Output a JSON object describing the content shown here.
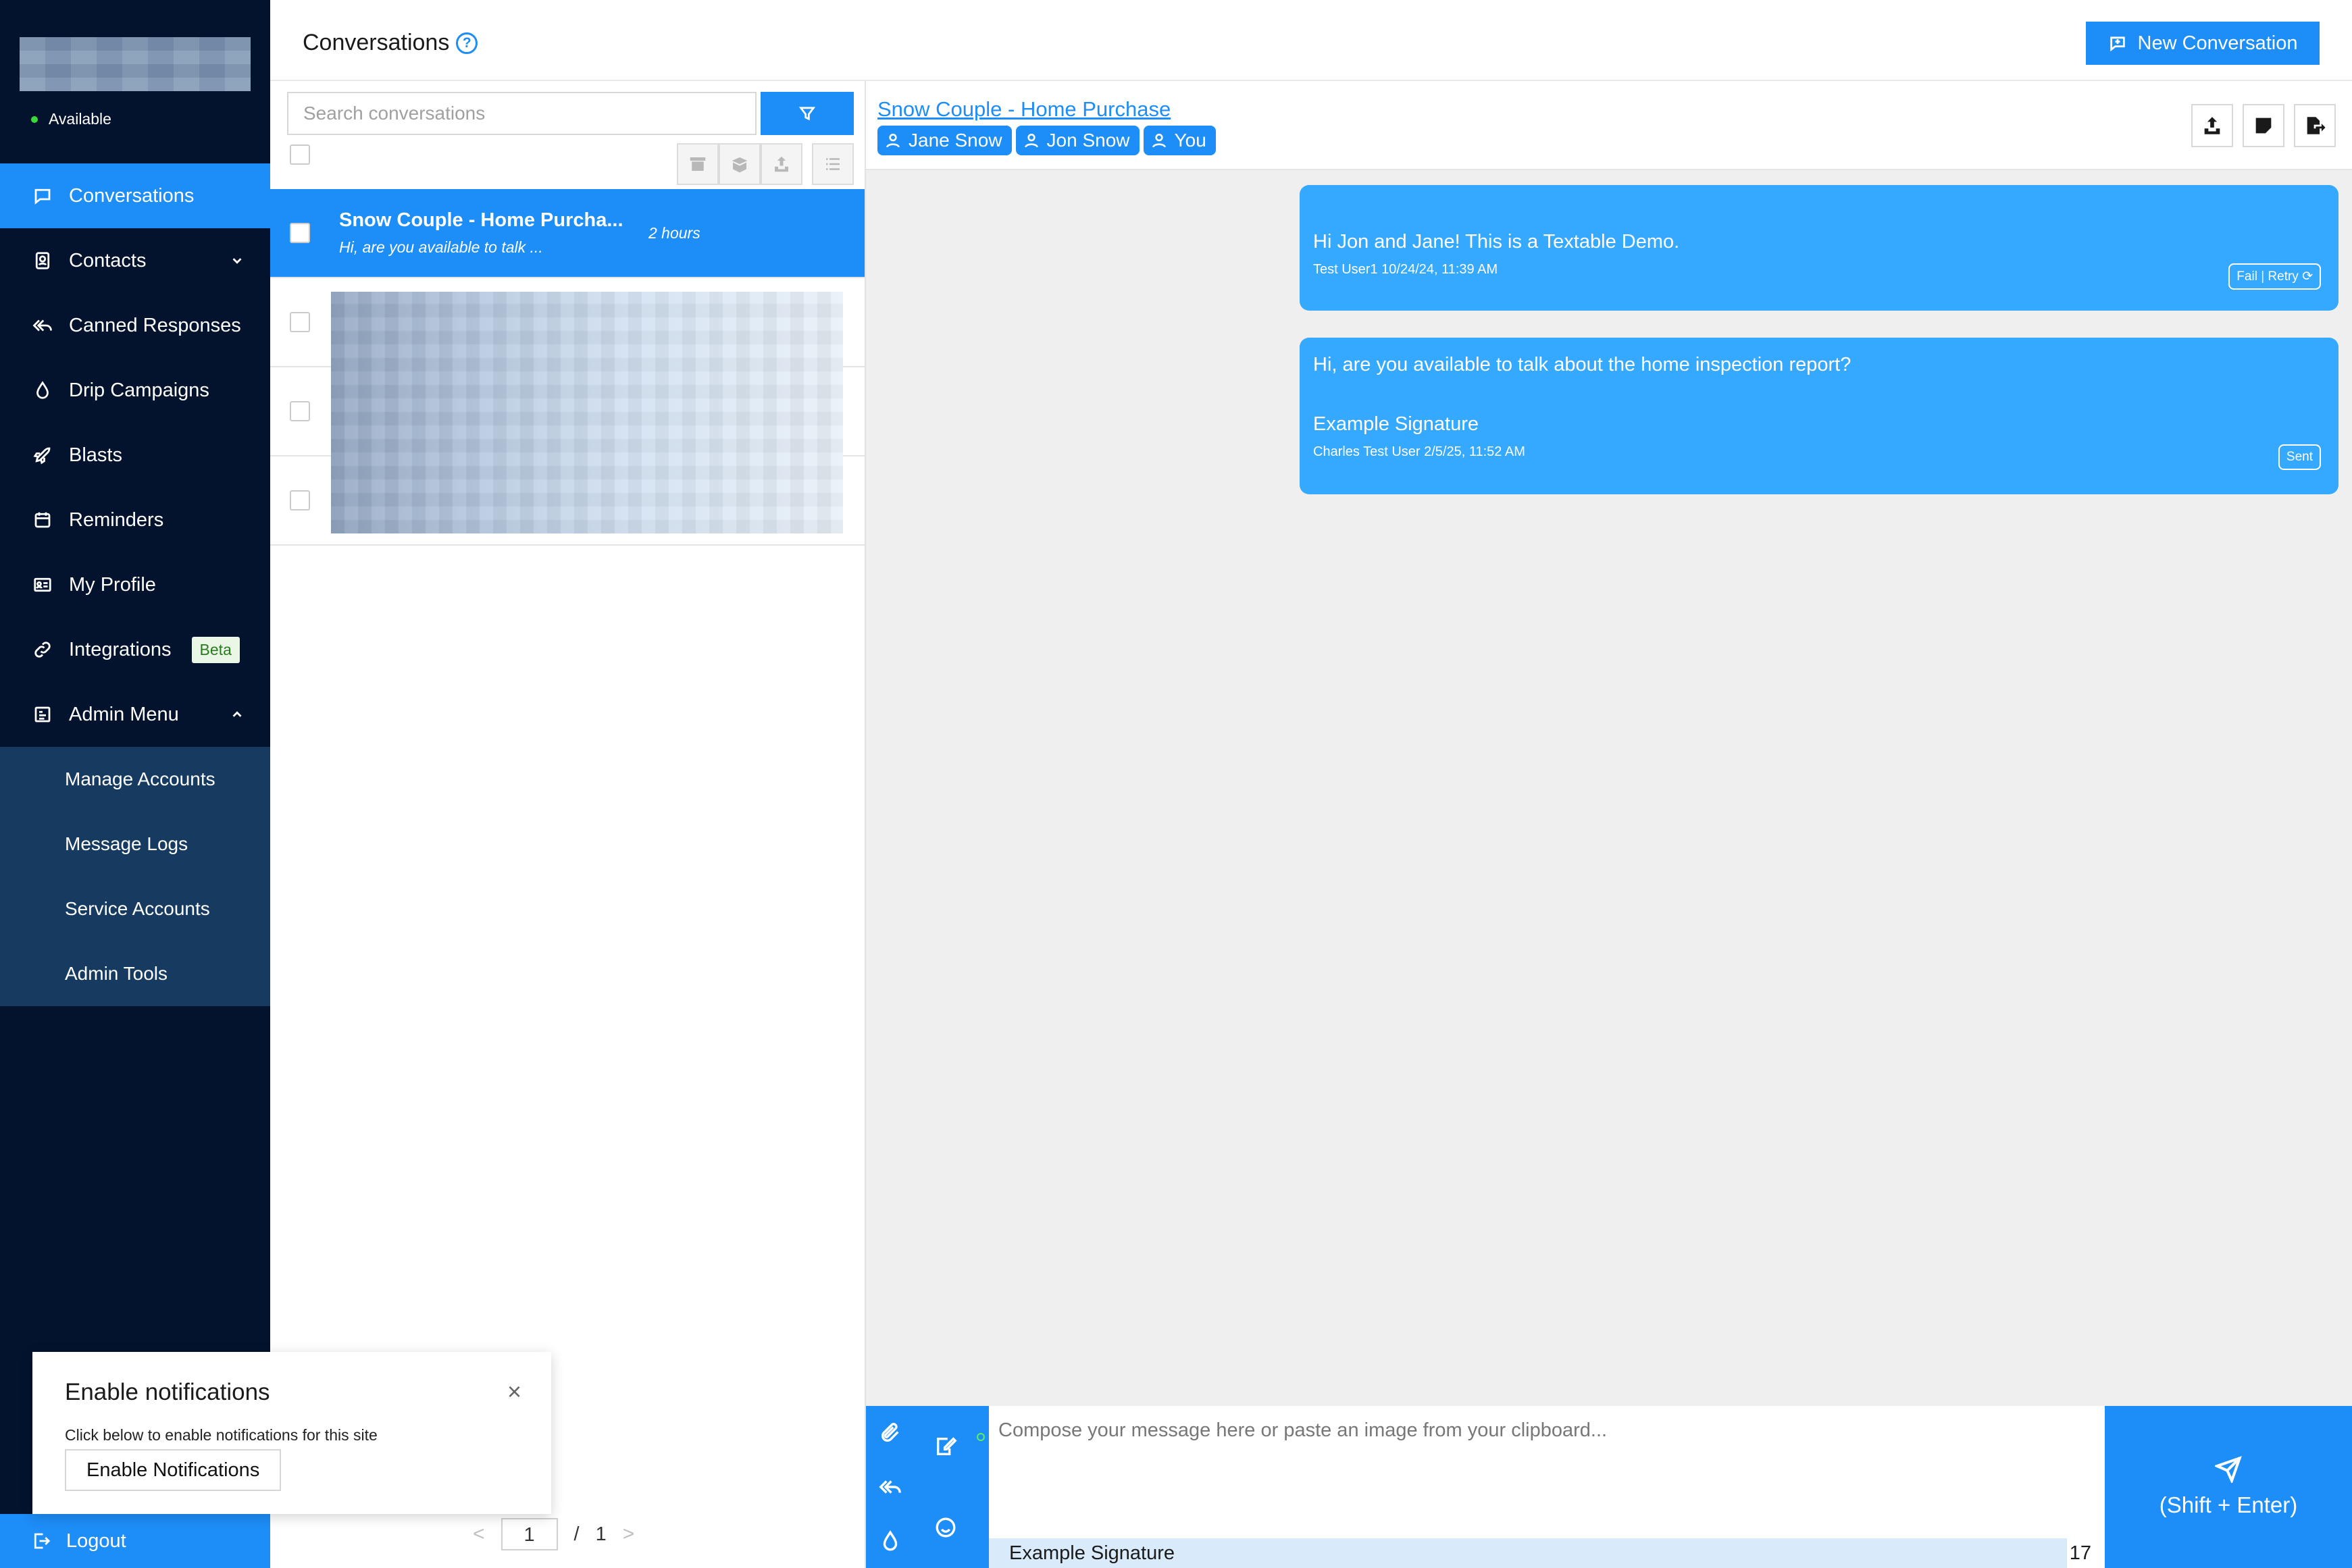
{
  "sidebar": {
    "status": "Available",
    "nav": [
      {
        "label": "Conversations",
        "icon": "chat-icon"
      },
      {
        "label": "Contacts",
        "icon": "contacts-icon"
      },
      {
        "label": "Canned Responses",
        "icon": "reply-all-icon"
      },
      {
        "label": "Drip Campaigns",
        "icon": "drop-icon"
      },
      {
        "label": "Blasts",
        "icon": "rocket-icon"
      },
      {
        "label": "Reminders",
        "icon": "calendar-icon"
      },
      {
        "label": "My Profile",
        "icon": "id-card-icon"
      },
      {
        "label": "Integrations",
        "icon": "link-icon"
      },
      {
        "label": "Admin Menu",
        "icon": "admin-icon"
      }
    ],
    "beta_badge": "Beta",
    "admin_items": [
      "Manage Accounts",
      "Message Logs",
      "Service Accounts",
      "Admin Tools"
    ],
    "logout": "Logout"
  },
  "header": {
    "title": "Conversations",
    "help": "?",
    "new_conversation": "New Conversation"
  },
  "list": {
    "search_placeholder": "Search conversations",
    "conversations": [
      {
        "title": "Snow Couple - Home Purcha...",
        "snippet": "Hi, are you available to talk ...",
        "time": "2 hours"
      }
    ],
    "pager": {
      "prev": "<",
      "current": "1",
      "separator": "/",
      "total": "1",
      "next": ">"
    }
  },
  "chat": {
    "title": "Snow Couple - Home Purchase",
    "participants": [
      "Jane Snow",
      "Jon Snow",
      "You"
    ],
    "messages": [
      {
        "text": "Hi Jon and Jane! This is a Textable Demo.",
        "meta": "Test User1 10/24/24, 11:39 AM",
        "status": "Fail | Retry ⟳"
      },
      {
        "text": "Hi, are you available to talk about the home inspection report?",
        "signature": "Example Signature",
        "meta": "Charles Test User 2/5/25, 11:52 AM",
        "status": "Sent"
      }
    ]
  },
  "composer": {
    "placeholder": "Compose your message here or paste an image from your clipboard...",
    "signature": "Example Signature",
    "char_count": "17",
    "send_label": "(Shift + Enter)"
  },
  "notification": {
    "title": "Enable notifications",
    "description": "Click below to enable notifications for this site",
    "button": "Enable Notifications",
    "close": "×"
  },
  "colors": {
    "primary": "#1d8df7",
    "sidebar": "#03132e",
    "submenu": "#173a61",
    "bubble": "#35a8ff"
  }
}
